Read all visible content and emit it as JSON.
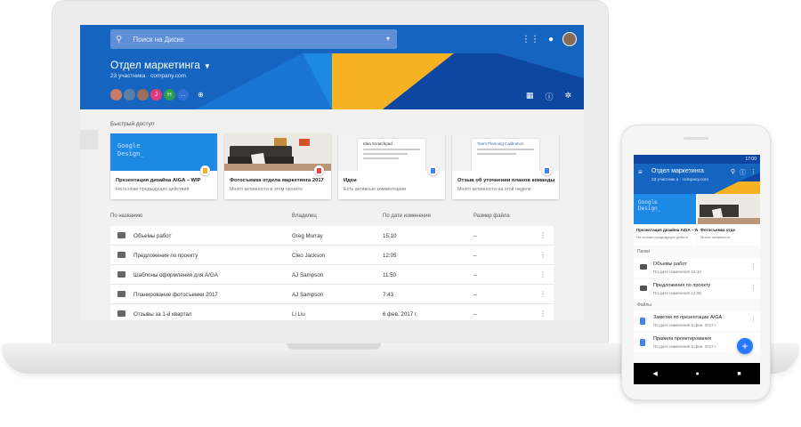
{
  "colors": {
    "primary_blue": "#1565c0",
    "accent_yellow": "#f6b221",
    "dark_blue": "#0d47a1",
    "fab_blue": "#2979ff"
  },
  "desktop": {
    "search": {
      "icon": "search-icon",
      "placeholder": "Поиск на Диске"
    },
    "header": {
      "apps_icon": "apps-grid-icon",
      "notifications_icon": "notifications-icon",
      "team_name": "Отдел маркетинга",
      "team_sub": "23 участника · company.com",
      "avatars": [
        {
          "letter": "",
          "color": "#c97b63"
        },
        {
          "letter": "",
          "color": "#5d7fa3"
        },
        {
          "letter": "",
          "color": "#9b6d5a"
        },
        {
          "letter": "J",
          "color": "#e53978"
        },
        {
          "letter": "H",
          "color": "#2e9d4f"
        },
        {
          "letter": "…",
          "color": "#2f6fd1"
        }
      ],
      "add_people_icon": "add-people-icon",
      "grid_view_icon": "grid-view-icon",
      "info_icon": "info-icon",
      "settings_icon": "gear-icon"
    },
    "quick_access": {
      "label": "Быстрый доступ",
      "cards": [
        {
          "name": "Презентация дизайна AIGA – WIP",
          "meta": "На основе предыдущих действий",
          "thumb_text": "Google\nDesign_"
        },
        {
          "name": "Фотосъемка отдела маркетинга 2017",
          "meta": "Много активности в этом проекте",
          "thumb_text": ""
        },
        {
          "name": "Идеи",
          "meta": "Есть активные комментарии",
          "thumb_text": "Idea Scratchpad"
        },
        {
          "name": "Отзыв об уточнении планов команды",
          "meta": "Много активности на этой неделе",
          "thumb_text": "Team Planning Calibration"
        }
      ]
    },
    "columns": {
      "name": "По названию",
      "owner": "Владелец",
      "modified": "По дате изменения",
      "size": "Размер файла"
    },
    "files": [
      {
        "name": "Объемы работ",
        "owner": "Greg Murray",
        "modified": "15:10",
        "size": "–"
      },
      {
        "name": "Предложения по проекту",
        "owner": "Cleo Jackson",
        "modified": "12:05",
        "size": "–"
      },
      {
        "name": "Шаблоны оформления для A/GA",
        "owner": "AJ Sampson",
        "modified": "11:50",
        "size": "–"
      },
      {
        "name": "Планирование фотосъемки 2017",
        "owner": "AJ Sampson",
        "modified": "7:43",
        "size": "–"
      },
      {
        "name": "Отзывы за 1-й квартал",
        "owner": "Li Liu",
        "modified": "6 фев. 2017 г.",
        "size": "–"
      }
    ]
  },
  "phone": {
    "status_time": "17:00",
    "title": "Отдел маркетинга",
    "sub": "23 участник а · company.com",
    "cards": [
      {
        "name": "Презентация дизайна AIGA – W",
        "meta": "На основе предыдущих действ",
        "thumb_text": "Google\nDesign_"
      },
      {
        "name": "Фотосъемка отде",
        "meta": "Много активности"
      }
    ],
    "folders_label": "Папки",
    "folders": [
      {
        "name": "Объемы работ",
        "meta": "По дате изменения 15:10"
      },
      {
        "name": "Предложения по проекту",
        "meta": "По дате изменения 12:05"
      }
    ],
    "files_label": "Файлы",
    "files": [
      {
        "name": "Заметки по презентации A/GA",
        "meta": "По дате изменения 6 фев. 2017 г."
      },
      {
        "name": "Правила проектирования",
        "meta": "По дате изменения 6 фев. 2017 г."
      }
    ],
    "fab": "+"
  }
}
